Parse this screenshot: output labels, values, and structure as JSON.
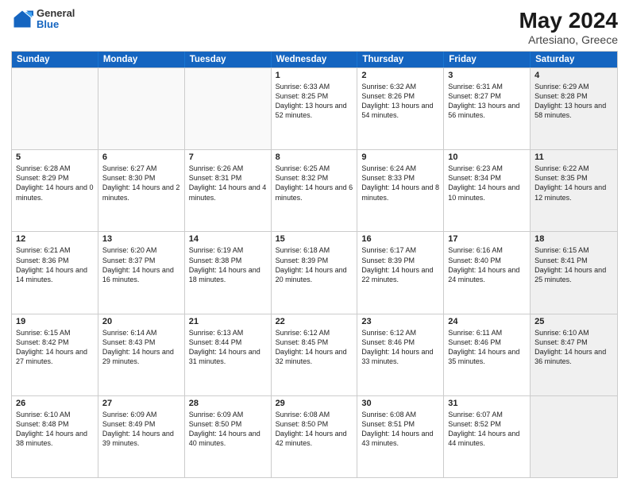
{
  "header": {
    "logo": {
      "general": "General",
      "blue": "Blue"
    },
    "title": "May 2024",
    "location": "Artesiano, Greece"
  },
  "weekdays": [
    "Sunday",
    "Monday",
    "Tuesday",
    "Wednesday",
    "Thursday",
    "Friday",
    "Saturday"
  ],
  "rows": [
    [
      {
        "day": "",
        "text": "",
        "empty": true
      },
      {
        "day": "",
        "text": "",
        "empty": true
      },
      {
        "day": "",
        "text": "",
        "empty": true
      },
      {
        "day": "1",
        "text": "Sunrise: 6:33 AM\nSunset: 8:25 PM\nDaylight: 13 hours\nand 52 minutes.",
        "empty": false
      },
      {
        "day": "2",
        "text": "Sunrise: 6:32 AM\nSunset: 8:26 PM\nDaylight: 13 hours\nand 54 minutes.",
        "empty": false
      },
      {
        "day": "3",
        "text": "Sunrise: 6:31 AM\nSunset: 8:27 PM\nDaylight: 13 hours\nand 56 minutes.",
        "empty": false
      },
      {
        "day": "4",
        "text": "Sunrise: 6:29 AM\nSunset: 8:28 PM\nDaylight: 13 hours\nand 58 minutes.",
        "empty": false,
        "shaded": true
      }
    ],
    [
      {
        "day": "5",
        "text": "Sunrise: 6:28 AM\nSunset: 8:29 PM\nDaylight: 14 hours\nand 0 minutes.",
        "empty": false
      },
      {
        "day": "6",
        "text": "Sunrise: 6:27 AM\nSunset: 8:30 PM\nDaylight: 14 hours\nand 2 minutes.",
        "empty": false
      },
      {
        "day": "7",
        "text": "Sunrise: 6:26 AM\nSunset: 8:31 PM\nDaylight: 14 hours\nand 4 minutes.",
        "empty": false
      },
      {
        "day": "8",
        "text": "Sunrise: 6:25 AM\nSunset: 8:32 PM\nDaylight: 14 hours\nand 6 minutes.",
        "empty": false
      },
      {
        "day": "9",
        "text": "Sunrise: 6:24 AM\nSunset: 8:33 PM\nDaylight: 14 hours\nand 8 minutes.",
        "empty": false
      },
      {
        "day": "10",
        "text": "Sunrise: 6:23 AM\nSunset: 8:34 PM\nDaylight: 14 hours\nand 10 minutes.",
        "empty": false
      },
      {
        "day": "11",
        "text": "Sunrise: 6:22 AM\nSunset: 8:35 PM\nDaylight: 14 hours\nand 12 minutes.",
        "empty": false,
        "shaded": true
      }
    ],
    [
      {
        "day": "12",
        "text": "Sunrise: 6:21 AM\nSunset: 8:36 PM\nDaylight: 14 hours\nand 14 minutes.",
        "empty": false
      },
      {
        "day": "13",
        "text": "Sunrise: 6:20 AM\nSunset: 8:37 PM\nDaylight: 14 hours\nand 16 minutes.",
        "empty": false
      },
      {
        "day": "14",
        "text": "Sunrise: 6:19 AM\nSunset: 8:38 PM\nDaylight: 14 hours\nand 18 minutes.",
        "empty": false
      },
      {
        "day": "15",
        "text": "Sunrise: 6:18 AM\nSunset: 8:39 PM\nDaylight: 14 hours\nand 20 minutes.",
        "empty": false
      },
      {
        "day": "16",
        "text": "Sunrise: 6:17 AM\nSunset: 8:39 PM\nDaylight: 14 hours\nand 22 minutes.",
        "empty": false
      },
      {
        "day": "17",
        "text": "Sunrise: 6:16 AM\nSunset: 8:40 PM\nDaylight: 14 hours\nand 24 minutes.",
        "empty": false
      },
      {
        "day": "18",
        "text": "Sunrise: 6:15 AM\nSunset: 8:41 PM\nDaylight: 14 hours\nand 25 minutes.",
        "empty": false,
        "shaded": true
      }
    ],
    [
      {
        "day": "19",
        "text": "Sunrise: 6:15 AM\nSunset: 8:42 PM\nDaylight: 14 hours\nand 27 minutes.",
        "empty": false
      },
      {
        "day": "20",
        "text": "Sunrise: 6:14 AM\nSunset: 8:43 PM\nDaylight: 14 hours\nand 29 minutes.",
        "empty": false
      },
      {
        "day": "21",
        "text": "Sunrise: 6:13 AM\nSunset: 8:44 PM\nDaylight: 14 hours\nand 31 minutes.",
        "empty": false
      },
      {
        "day": "22",
        "text": "Sunrise: 6:12 AM\nSunset: 8:45 PM\nDaylight: 14 hours\nand 32 minutes.",
        "empty": false
      },
      {
        "day": "23",
        "text": "Sunrise: 6:12 AM\nSunset: 8:46 PM\nDaylight: 14 hours\nand 33 minutes.",
        "empty": false
      },
      {
        "day": "24",
        "text": "Sunrise: 6:11 AM\nSunset: 8:46 PM\nDaylight: 14 hours\nand 35 minutes.",
        "empty": false
      },
      {
        "day": "25",
        "text": "Sunrise: 6:10 AM\nSunset: 8:47 PM\nDaylight: 14 hours\nand 36 minutes.",
        "empty": false,
        "shaded": true
      }
    ],
    [
      {
        "day": "26",
        "text": "Sunrise: 6:10 AM\nSunset: 8:48 PM\nDaylight: 14 hours\nand 38 minutes.",
        "empty": false
      },
      {
        "day": "27",
        "text": "Sunrise: 6:09 AM\nSunset: 8:49 PM\nDaylight: 14 hours\nand 39 minutes.",
        "empty": false
      },
      {
        "day": "28",
        "text": "Sunrise: 6:09 AM\nSunset: 8:50 PM\nDaylight: 14 hours\nand 40 minutes.",
        "empty": false
      },
      {
        "day": "29",
        "text": "Sunrise: 6:08 AM\nSunset: 8:50 PM\nDaylight: 14 hours\nand 42 minutes.",
        "empty": false
      },
      {
        "day": "30",
        "text": "Sunrise: 6:08 AM\nSunset: 8:51 PM\nDaylight: 14 hours\nand 43 minutes.",
        "empty": false
      },
      {
        "day": "31",
        "text": "Sunrise: 6:07 AM\nSunset: 8:52 PM\nDaylight: 14 hours\nand 44 minutes.",
        "empty": false
      },
      {
        "day": "",
        "text": "",
        "empty": true,
        "shaded": true
      }
    ]
  ]
}
